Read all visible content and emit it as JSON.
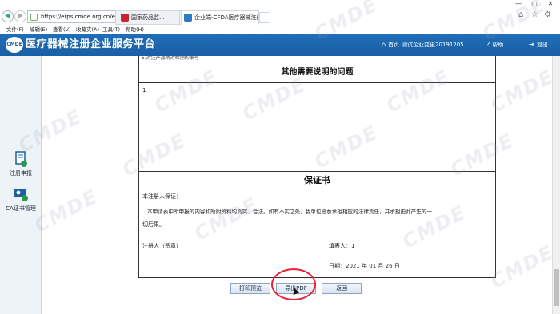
{
  "browser": {
    "url": "https://erps.cmde.org.cn/ecde/",
    "tabs": [
      {
        "label": "国家药品监...",
        "active": false
      },
      {
        "label": "企业端-CFDA医疗器械注册...",
        "active": true
      }
    ],
    "menu": [
      "文件(F)",
      "编辑(E)",
      "查看(V)",
      "收藏夹(A)",
      "工具(T)",
      "帮助(H)"
    ],
    "window_controls": [
      "—",
      "□",
      "✕"
    ]
  },
  "header": {
    "logo": "CMDE",
    "title": "医疗器械注册企业服务平台",
    "home": "首页",
    "user": "测试企业变更20191205",
    "help": "帮助",
    "logout": "退出",
    "accent": "#1a5fa4"
  },
  "sidebar": {
    "items": [
      {
        "label": "注册申报",
        "icon": "document-edit-icon"
      },
      {
        "label": "CA证书管理",
        "icon": "ca-certificate-icon"
      }
    ]
  },
  "document": {
    "cut_row": "5.对注产品所对检测的编号",
    "other_issues_title": "其他需要说明的问题",
    "other_issues_value": "1",
    "guarantee_title": "保证书",
    "guarantee_intro": "本注册人保证：",
    "guarantee_body_1": "本申请表中所申报的内容和所附资料均真实、合法。如有不实之处，我单位愿意承担相应的法律责任，并承担由此产生的一",
    "guarantee_body_2": "切后果。",
    "registrant_label": "注册人（签章）",
    "filler_label": "填表人：1",
    "date_label": "日期：2021 年 01 月 26 日"
  },
  "buttons": {
    "print": "打印预览",
    "export_pdf": "导出PDF",
    "back": "返回"
  },
  "watermark": "CMDE"
}
